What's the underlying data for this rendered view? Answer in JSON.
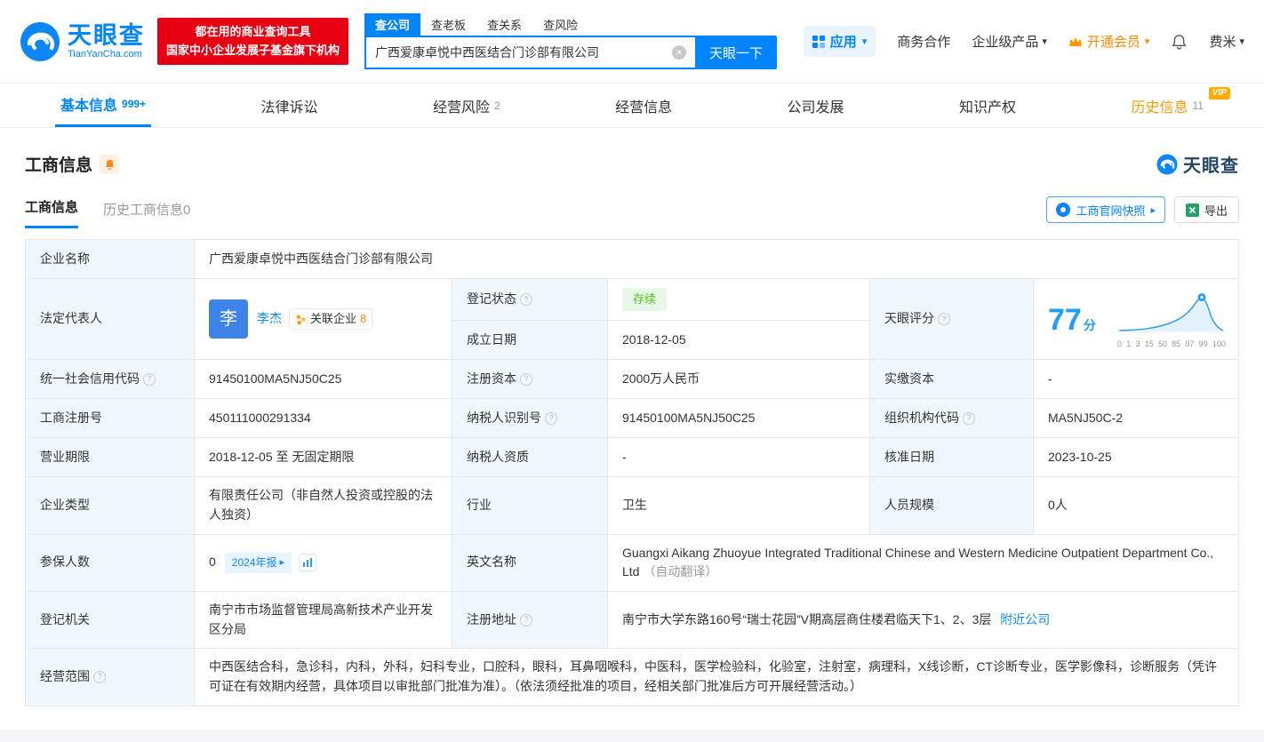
{
  "icons": {
    "caret_down": "▾",
    "arrow_right": "▸",
    "clear": "✕",
    "question": "?"
  },
  "header": {
    "logo": {
      "brand": "天眼查",
      "domain": "TianYanCha.com"
    },
    "promo": {
      "line1": "都在用的商业查询工具",
      "line2": "国家中小企业发展子基金旗下机构"
    },
    "search": {
      "tabs": [
        {
          "label": "查公司"
        },
        {
          "label": "查老板"
        },
        {
          "label": "查关系"
        },
        {
          "label": "查风险"
        }
      ],
      "value": "广西爱康卓悦中西医结合门诊部有限公司",
      "button_label": "天眼一下"
    },
    "nav_right": {
      "apps": "应用",
      "business_cooperation": "商务合作",
      "enterprise_products": "企业级产品",
      "open_vip": "开通会员",
      "username": "费米"
    }
  },
  "tabs": [
    {
      "label": "基本信息",
      "badge": "999+"
    },
    {
      "label": "法律诉讼"
    },
    {
      "label": "经营风险",
      "badge": "2"
    },
    {
      "label": "经营信息"
    },
    {
      "label": "公司发展"
    },
    {
      "label": "知识产权"
    },
    {
      "label": "历史信息",
      "badge": "11",
      "vip": "VIP"
    }
  ],
  "section": {
    "title": "工商信息",
    "brand_watermark": "天眼查",
    "subtabs": [
      {
        "label": "工商信息"
      },
      {
        "label": "历史工商信息0"
      }
    ],
    "snapshot_button": "工商官网快照",
    "export_button": "导出"
  },
  "table": {
    "company_name": {
      "label": "企业名称",
      "value": "广西爱康卓悦中西医结合门诊部有限公司"
    },
    "legal_rep": {
      "label": "法定代表人",
      "avatar": "李",
      "name": "李杰",
      "related_label": "关联企业",
      "related_count": "8"
    },
    "reg_status": {
      "label": "登记状态",
      "value": "存续"
    },
    "est_date": {
      "label": "成立日期",
      "value": "2018-12-05"
    },
    "score": {
      "label": "天眼评分",
      "value": "77",
      "unit": "分",
      "axis": [
        "0",
        "1",
        "3",
        "15",
        "50",
        "85",
        "97",
        "99",
        "100"
      ]
    },
    "credit_code": {
      "label": "统一社会信用代码",
      "value": "91450100MA5NJ50C25"
    },
    "reg_capital": {
      "label": "注册资本",
      "value": "2000万人民币"
    },
    "paid_capital": {
      "label": "实缴资本",
      "value": "-"
    },
    "reg_number": {
      "label": "工商注册号",
      "value": "450111000291334"
    },
    "taxpayer_id": {
      "label": "纳税人识别号",
      "value": "91450100MA5NJ50C25"
    },
    "org_code": {
      "label": "组织机构代码",
      "value": "MA5NJ50C-2"
    },
    "business_term": {
      "label": "营业期限",
      "value": "2018-12-05 至 无固定期限"
    },
    "taxpayer_quality": {
      "label": "纳税人资质",
      "value": "-"
    },
    "approval_date": {
      "label": "核准日期",
      "value": "2023-10-25"
    },
    "company_type": {
      "label": "企业类型",
      "value": "有限责任公司（非自然人投资或控股的法人独资）"
    },
    "industry": {
      "label": "行业",
      "value": "卫生"
    },
    "staff_size": {
      "label": "人员规模",
      "value": "0人"
    },
    "insured": {
      "label": "参保人数",
      "value": "0",
      "report_badge": "2024年报"
    },
    "english_name": {
      "label": "英文名称",
      "value": "Guangxi Aikang Zhuoyue Integrated Traditional Chinese and Western Medicine Outpatient Department Co., Ltd",
      "note": "（自动翻译）"
    },
    "reg_authority": {
      "label": "登记机关",
      "value": "南宁市市场监督管理局高新技术产业开发区分局"
    },
    "reg_address": {
      "label": "注册地址",
      "value": "南宁市大学东路160号“瑞士花园”V期高层商住楼君临天下1、2、3层",
      "nearby_link": "附近公司"
    },
    "business_scope": {
      "label": "经营范围",
      "value": "中西医结合科，急诊科，内科，外科，妇科专业，口腔科，眼科，耳鼻咽喉科，中医科，医学检验科，化验室，注射室，病理科，X线诊断，CT诊断专业，医学影像科，诊断服务（凭许可证在有效期内经营，具体项目以审批部门批准为准）。（依法须经批准的项目，经相关部门批准后方可开展经营活动。）"
    }
  }
}
